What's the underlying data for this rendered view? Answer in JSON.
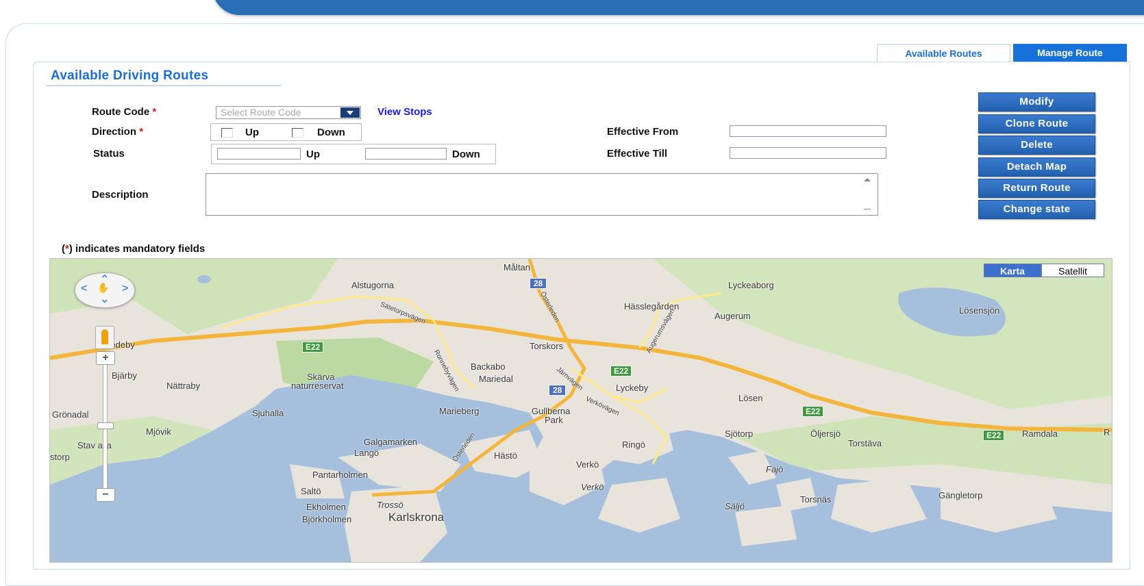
{
  "tabs": {
    "available": "Available Routes",
    "manage": "Manage Route"
  },
  "section_title": "Available Driving Routes",
  "form": {
    "route_code_label": "Route Code",
    "required_mark": "*",
    "route_code_placeholder": "Select Route Code",
    "view_stops": "View Stops",
    "direction_label": "Direction",
    "direction_up": "Up",
    "direction_down": "Down",
    "status_label": "Status",
    "status_up": "Up",
    "status_down": "Down",
    "effective_from_label": "Effective From",
    "effective_till_label": "Effective Till",
    "description_label": "Description",
    "mandatory_prefix": "(",
    "mandatory_mark": "*",
    "mandatory_suffix": ") indicates mandatory fields"
  },
  "buttons": {
    "modify": "Modify",
    "clone_route": "Clone Route",
    "delete": "Delete",
    "detach_map": "Detach Map",
    "return_route": "Return Route",
    "change_state": "Change state"
  },
  "map": {
    "type_karta": "Karta",
    "type_satellit": "Satellit",
    "labels": {
      "maltan": "Måltan",
      "alstugorna": "Alstugorna",
      "lyckeaborg": "Lyckeaborg",
      "hasslegarden": "Hässlegården",
      "augerum": "Augerum",
      "losensjon": "Lösensjön",
      "gredeby": "Gredeby",
      "torskors": "Torskors",
      "backabo": "Backabo",
      "mariedal": "Mariedal",
      "bjarby": "Bjärby",
      "nattraby": "Nättraby",
      "skarva": "Skärva",
      "naturreservat": "naturreservat",
      "lyckeby": "Lyckeby",
      "losen": "Lösen",
      "gronadal": "Grönadal",
      "sjuhalla": "Sjuhalla",
      "marieberg": "Marieberg",
      "gullberna": "Gullberna",
      "park": "Park",
      "mjovik": "Mjövik",
      "sjotorp": "Sjötorp",
      "oljersjo": "Öljersjö",
      "ramdala": "Ramdala",
      "r_edge": "R",
      "torstava": "Torstäva",
      "stavealla": "Stav    alla",
      "galgamarken": "Galgamarken",
      "ringo": "Ringö",
      "storp": "storp",
      "lango": "Langö",
      "hasto": "Hästö",
      "verko": "Verkö",
      "fajo": "Fajö",
      "pantarholmen": "Pantarholmen",
      "verko2": "Verkö",
      "salto": "Saltö",
      "trosso": "Trossö",
      "torsnas": "Torsnäs",
      "gangletorp": "Gängletorp",
      "ekholmen": "Ekholmen",
      "saljo": "Säljö",
      "bjorkholmen": "Björkholmen",
      "karlskrona": "Karlskrona",
      "satetorpsvagen": "Sätetorpsvägen",
      "ronnebyvagen": "Ronnebyvägen",
      "ostleden": "Österleden",
      "augerumsvagen": "Augerumsvägen",
      "verkovagen": "Verkövägen",
      "jarnvagen": "Järnvägen",
      "osterleden2": "Österleden"
    },
    "shields": {
      "e22_a": "E22",
      "e22_b": "E22",
      "e22_c": "E22",
      "e22_d": "E22",
      "r28_a": "28",
      "r28_b": "28"
    }
  }
}
